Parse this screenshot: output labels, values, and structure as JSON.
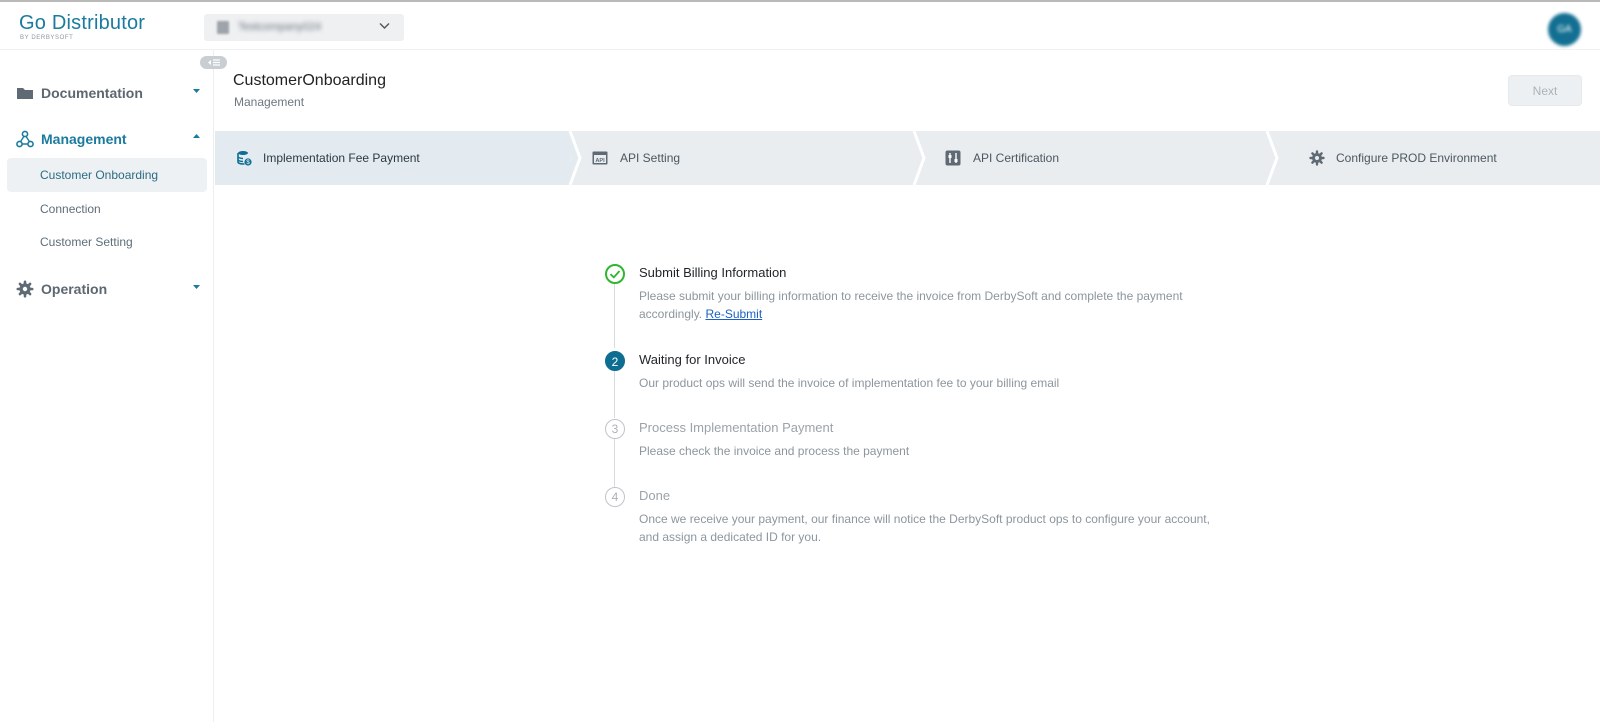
{
  "header": {
    "logo": "Go Distributor",
    "logo_sub": "BY DERBYSOFT",
    "company_select_value": "Testcompany024",
    "avatar_initials": "GA"
  },
  "sidebar": {
    "groups": [
      {
        "label": "Documentation",
        "icon": "folder-icon",
        "expanded": false
      },
      {
        "label": "Management",
        "icon": "network-icon",
        "expanded": true,
        "items": [
          "Customer Onboarding",
          "Connection",
          "Customer Setting"
        ],
        "active_item": "Customer Onboarding"
      },
      {
        "label": "Operation",
        "icon": "gear-icon",
        "expanded": false
      }
    ]
  },
  "page": {
    "title": "CustomerOnboarding",
    "subtitle": "Management",
    "next_label": "Next"
  },
  "stepper": {
    "steps": [
      {
        "label": "Implementation Fee Payment",
        "icon": "coin-stack-icon",
        "active": true
      },
      {
        "label": "API Setting",
        "icon": "api-window-icon",
        "active": false
      },
      {
        "label": "API Certification",
        "icon": "sliders-icon",
        "active": false
      },
      {
        "label": "Configure PROD Environment",
        "icon": "gear-icon",
        "active": false
      }
    ]
  },
  "progress": {
    "steps": [
      {
        "number": "1",
        "status": "done",
        "title": "Submit Billing Information",
        "desc": "Please submit your billing information to receive the invoice from DerbySoft and complete the payment accordingly.",
        "link": "Re-Submit"
      },
      {
        "number": "2",
        "status": "current",
        "title": "Waiting for Invoice",
        "desc": "Our product ops will send the invoice of implementation fee to your billing email"
      },
      {
        "number": "3",
        "status": "todo",
        "title": "Process Implementation Payment",
        "desc": "Please check the invoice and process the payment"
      },
      {
        "number": "4",
        "status": "todo",
        "title": "Done",
        "desc": "Once we receive your payment, our finance will notice the DerbySoft product ops to configure your account, and assign a dedicated ID for you."
      }
    ]
  },
  "colors": {
    "brand": "#1a7b9e",
    "done": "#2fb62f",
    "current": "#0d6e91",
    "link": "#1b5fc4"
  }
}
